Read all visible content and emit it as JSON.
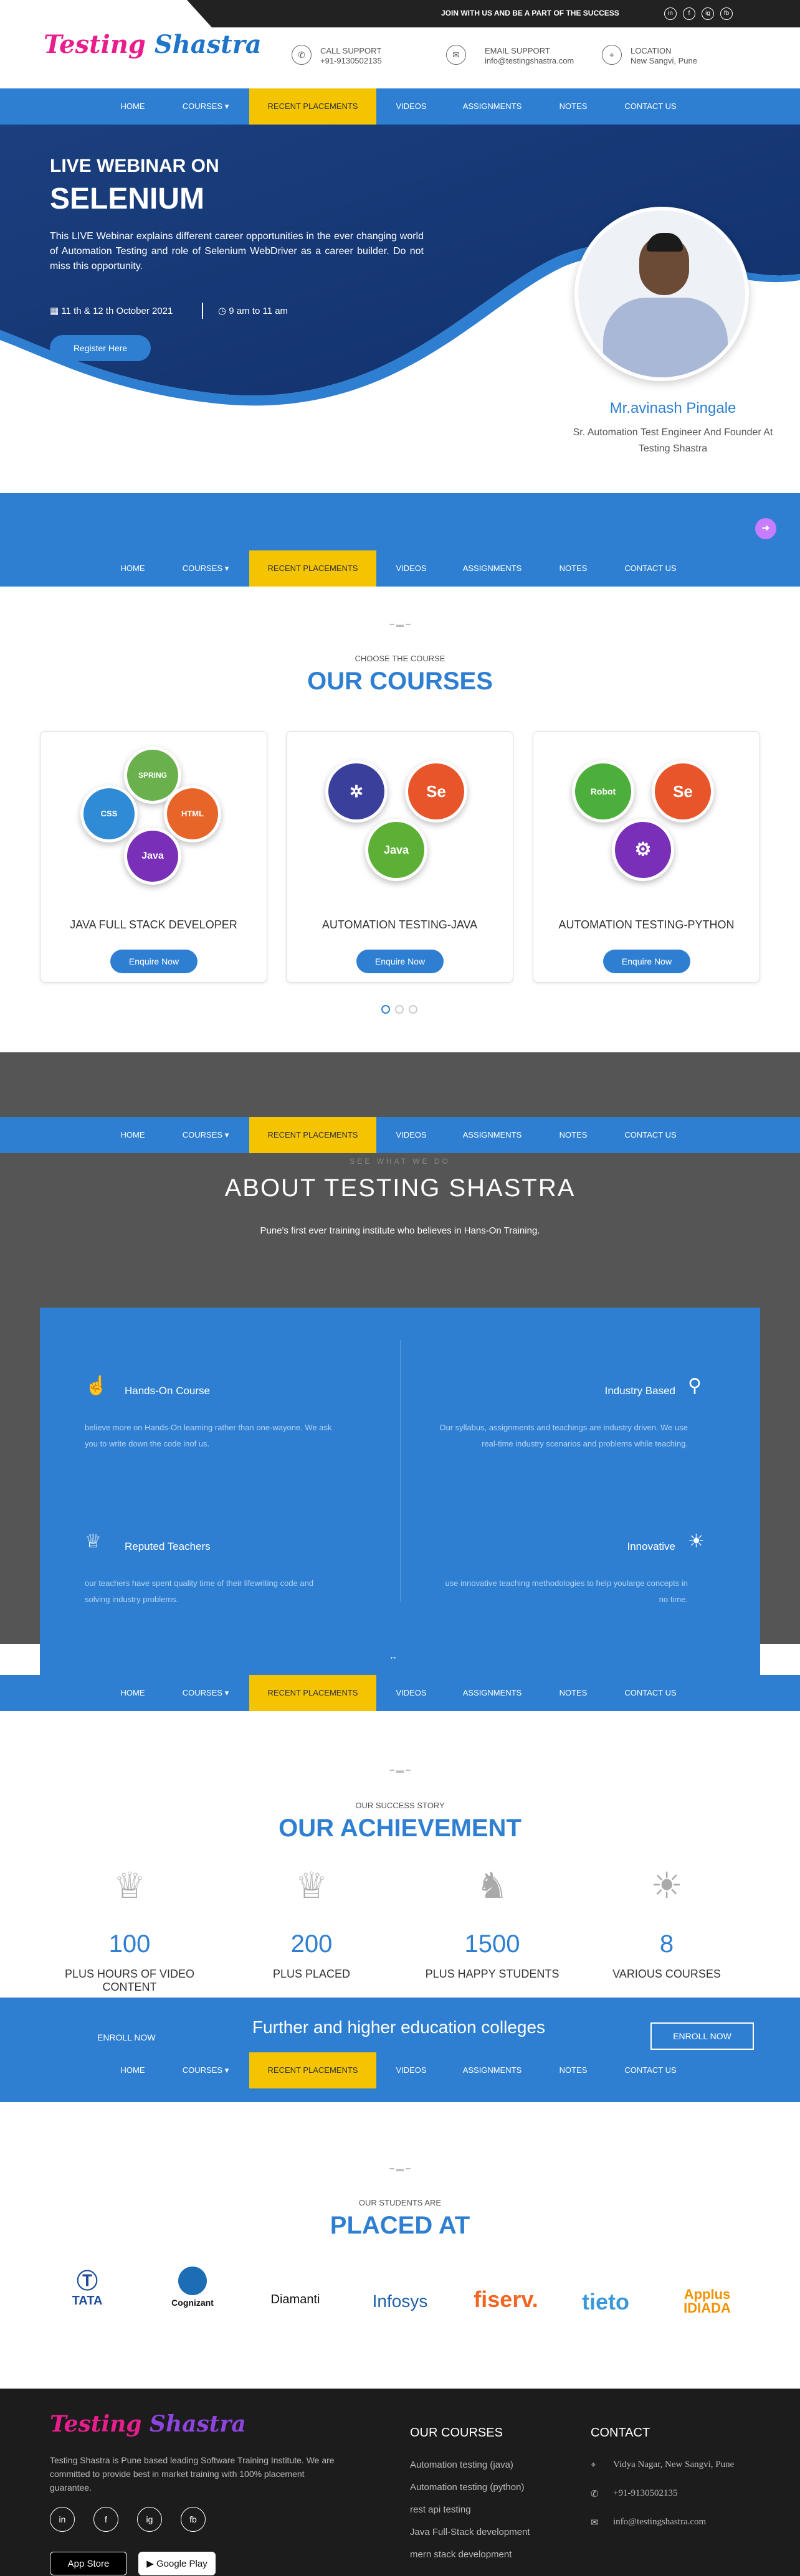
{
  "topbar": {
    "message": "JOIN WITH US AND BE A PART OF THE SUCCESS",
    "social": [
      "in",
      "f",
      "ig",
      "fb"
    ]
  },
  "brand": {
    "logo_a": "Testing",
    "logo_b": "Shastra"
  },
  "contact_info": {
    "call_label": "CALL SUPPORT",
    "call_value": "+91-9130502135",
    "email_label": "EMAIL SUPPORT",
    "email_value": "info@testingshastra.com",
    "loc_label": "LOCATION",
    "loc_value": "New Sangvi, Pune"
  },
  "nav": {
    "items": [
      "HOME",
      "COURSES",
      "RECENT PLACEMENTS",
      "VIDEOS",
      "ASSIGNMENTS",
      "NOTES",
      "CONTACT US"
    ]
  },
  "hero": {
    "line1": "LIVE WEBINAR ON",
    "line2": "SELENIUM",
    "desc": "This LIVE Webinar explains different career opportunities in the ever changing world of Automation Testing and role of Selenium WebDriver as a career builder. Do not miss this opportunity.",
    "date": "11 th & 12 th October 2021",
    "time": "9 am to 11 am",
    "register": "Register Here",
    "speaker_name": "Mr.avinash Pingale",
    "speaker_title": "Sr. Automation Test Engineer And Founder At Testing Shastra"
  },
  "courses": {
    "kicker": "CHOOSE THE COURSE",
    "title": "OUR COURSES",
    "enquire": "Enquire Now",
    "items": [
      {
        "name": "JAVA FULL STACK DEVELOPER"
      },
      {
        "name": "AUTOMATION TESTING-JAVA"
      },
      {
        "name": "AUTOMATION TESTING-PYTHON"
      }
    ],
    "badges": {
      "spring": "SPRING",
      "css": "CSS",
      "html": "HTML",
      "java": "Java",
      "se": "Se",
      "robot": "Robot"
    }
  },
  "about": {
    "kicker": "SEE WHAT WE DO",
    "title": "ABOUT TESTING SHASTRA",
    "sub": "Pune's first ever training institute who believes in Hans-On Training.",
    "features": [
      {
        "title": "Hands-On Course",
        "text": "believe more on Hands-On learning rather than one-wayone. We ask you to write down the code inof us."
      },
      {
        "title": "Industry Based",
        "text": "Our syllabus, assignments and teachings are industry driven. We use real-time industry scenarios and problems while teaching."
      },
      {
        "title": "Reputed Teachers",
        "text": "our teachers have spent quality time of their lifewriting code and solving industry problems."
      },
      {
        "title": "Innovative",
        "text": "use innovative teaching methodologies to help yoularge concepts in no time."
      }
    ]
  },
  "achievement": {
    "kicker": "OUR SUCCESS STORY",
    "title": "OUR ACHIEVEMENT",
    "stats": [
      {
        "num": "100",
        "label": "PLUS HOURS OF VIDEO CONTENT"
      },
      {
        "num": "200",
        "label": "PLUS PLACED"
      },
      {
        "num": "1500",
        "label": "PLUS HAPPY STUDENTS"
      },
      {
        "num": "8",
        "label": "VARIOUS COURSES"
      }
    ]
  },
  "banner": {
    "text": "Further and higher education colleges",
    "enroll": "ENROLL NOW"
  },
  "placed": {
    "kicker": "OUR STUDENTS ARE",
    "title": "PLACED AT",
    "logos": [
      "TATA",
      "Cognizant",
      "Diamanti",
      "Infosys",
      "fiserv.",
      "tieto",
      "Applus IDIADA"
    ]
  },
  "footer": {
    "about": "Testing Shastra is Pune based leading Software Training Institute. We are committed to provide best in market training with 100% placement guarantee.",
    "courses_title": "OUR COURSES",
    "courses": [
      "Automation testing (java)",
      "Automation testing (python)",
      "rest api testing",
      "Java Full-Stack development",
      "mern stack development"
    ],
    "contact_title": "CONTACT",
    "address": "Vidya Nagar, New Sangvi, Pune",
    "phone": "+91-9130502135",
    "email": "info@testingshastra.com",
    "appstore": "App Store",
    "googleplay": "Google Play"
  },
  "colors": {
    "primary": "#2e7fd2",
    "accent": "#f5c400",
    "navy": "#1a3f7a",
    "dark": "#1c1c1c"
  }
}
